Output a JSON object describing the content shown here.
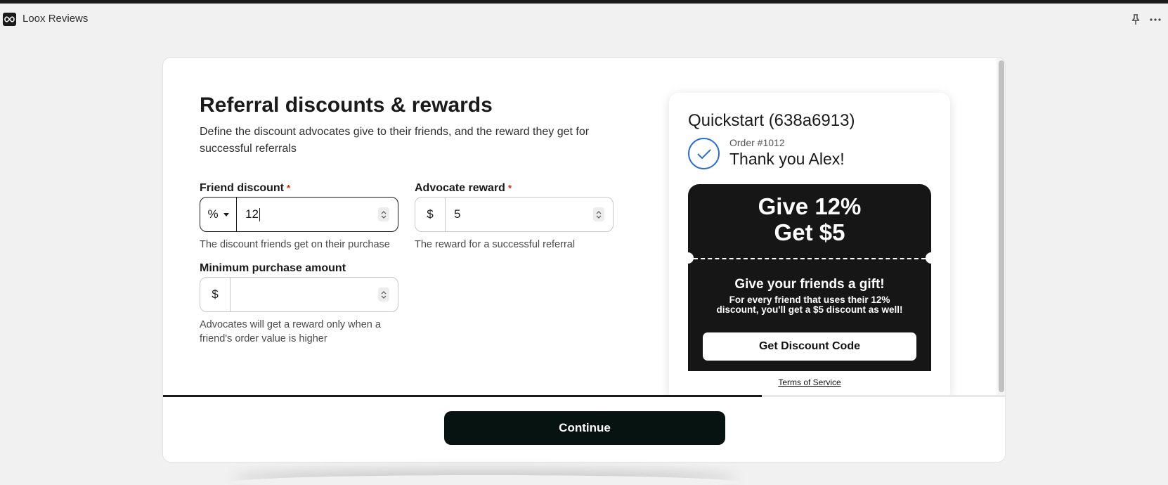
{
  "app": {
    "title": "Loox Reviews",
    "logo_icon": "infinity-logo-icon",
    "actions": [
      "pin-icon",
      "more-options-icon"
    ]
  },
  "page": {
    "heading": "Referral discounts & rewards",
    "subheading": "Define the discount advocates give to their friends, and the reward they get for successful referrals"
  },
  "form": {
    "friend_discount": {
      "label": "Friend discount",
      "required_mark": "*",
      "unit": "%",
      "value": "12",
      "help": "The discount friends get on their purchase"
    },
    "advocate_reward": {
      "label": "Advocate reward",
      "required_mark": "*",
      "unit": "$",
      "value": "5",
      "help": "The reward for a successful referral"
    },
    "minimum_purchase": {
      "label": "Minimum purchase amount",
      "unit": "$",
      "value": "",
      "help": "Advocates will get a reward only when a friend's order value is higher"
    }
  },
  "preview": {
    "store_name": "Quickstart (638a6913)",
    "order_number": "Order #1012",
    "thank_you": "Thank you Alex!",
    "coupon_line1": "Give 12%",
    "coupon_line2": "Get $5",
    "gift_title": "Give your friends a gift!",
    "gift_description": "For every friend that uses their 12% discount, you'll get a $5 discount as well!",
    "cta_label": "Get Discount Code",
    "terms_link": "Terms of Service"
  },
  "footer": {
    "progress_fraction": 0.71,
    "continue_label": "Continue"
  },
  "colors": {
    "required": "#c5280c",
    "check_accent": "#2c6ecb",
    "coupon_bg": "#161616",
    "continue_bg": "#071310"
  }
}
